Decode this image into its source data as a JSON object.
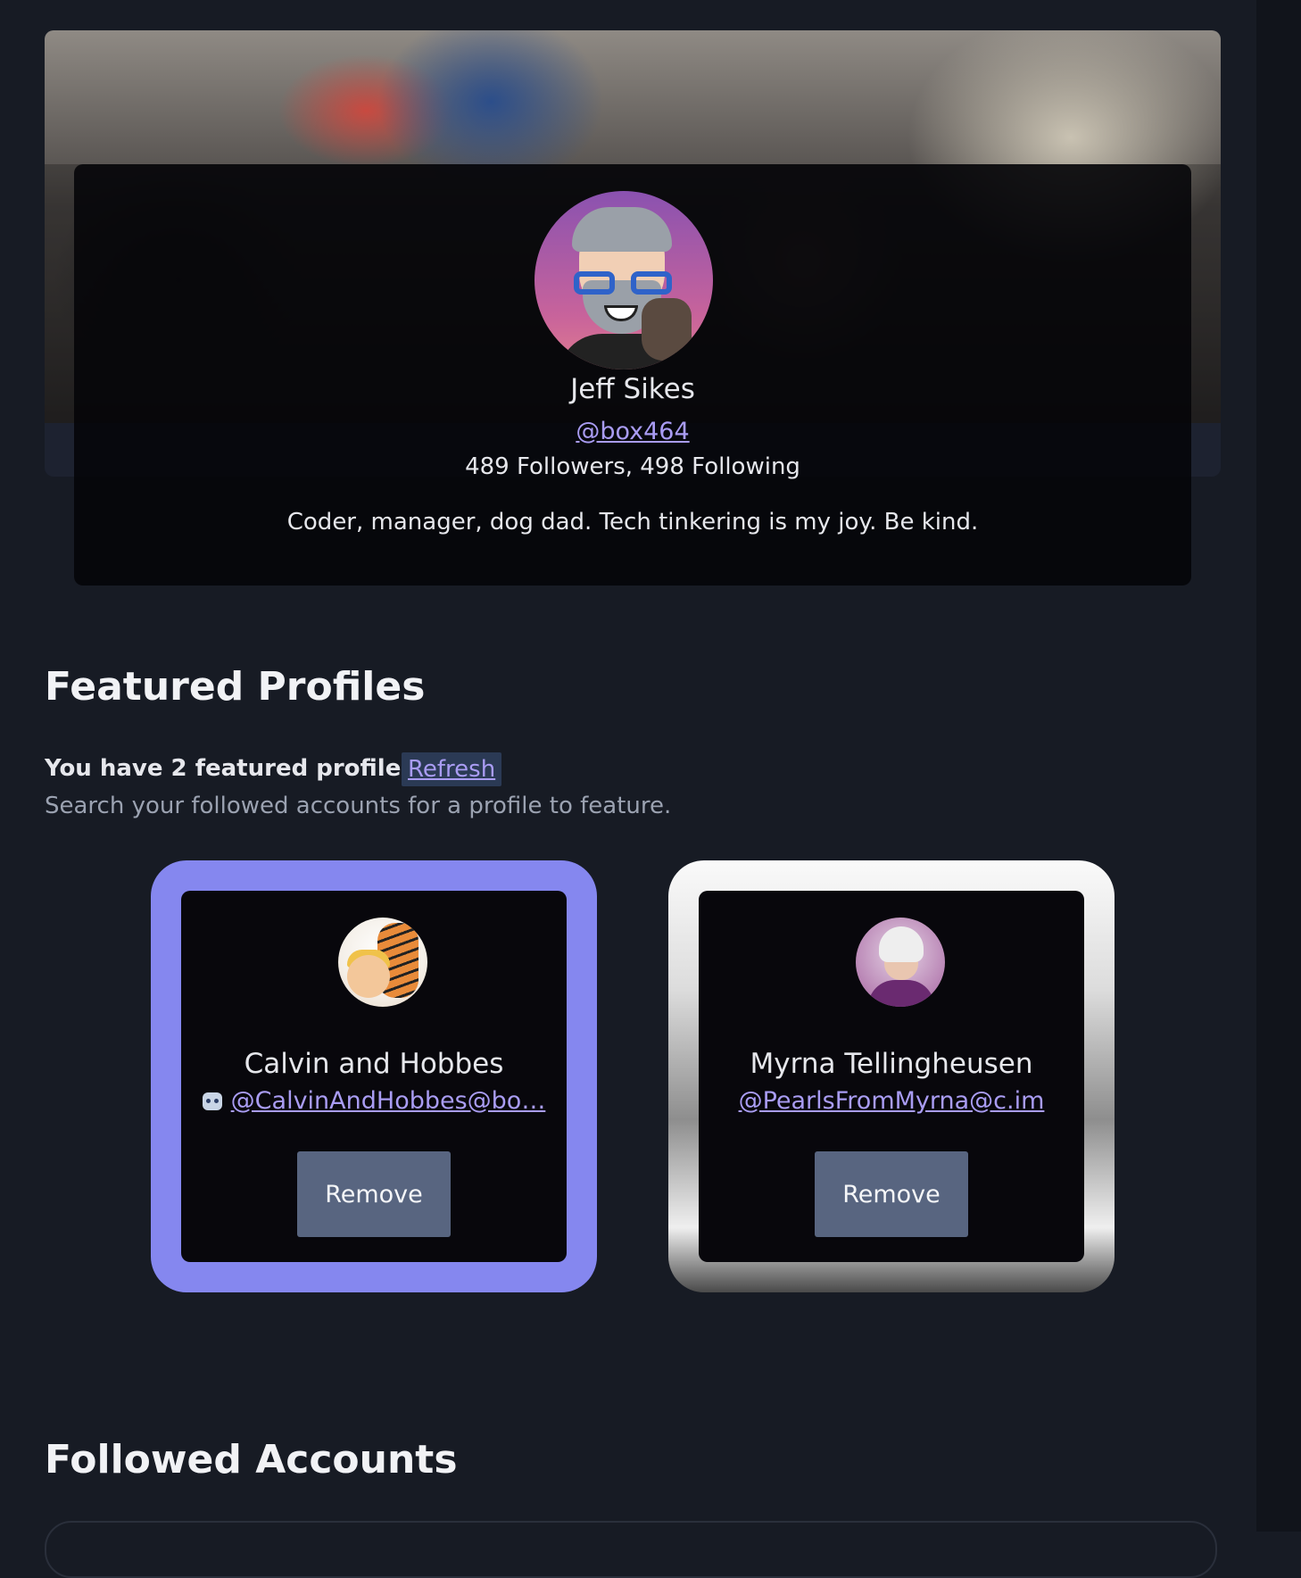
{
  "profile": {
    "name": "Jeff Sikes",
    "handle": "@box464",
    "stats": "489 Followers, 498 Following",
    "bio": "Coder, manager, dog dad. Tech tinkering is my joy. Be kind."
  },
  "featured": {
    "title": "Featured Profiles",
    "count_text": "You have 2 featured profiles.",
    "refresh_label": "Refresh",
    "search_hint": "Search your followed accounts for a profile to feature.",
    "cards": [
      {
        "name": "Calvin and Hobbes",
        "handle": "@CalvinAndHobbes@bo…",
        "bot": true,
        "remove_label": "Remove",
        "border_color": "#8587ef"
      },
      {
        "name": "Myrna Tellingheusen",
        "handle": "@PearlsFromMyrna@c.im",
        "bot": false,
        "remove_label": "Remove"
      }
    ]
  },
  "followed": {
    "title": "Followed Accounts"
  },
  "colors": {
    "background": "#171b24",
    "link": "#a99cf3",
    "button": "#586580",
    "accent_border": "#8587ef"
  }
}
